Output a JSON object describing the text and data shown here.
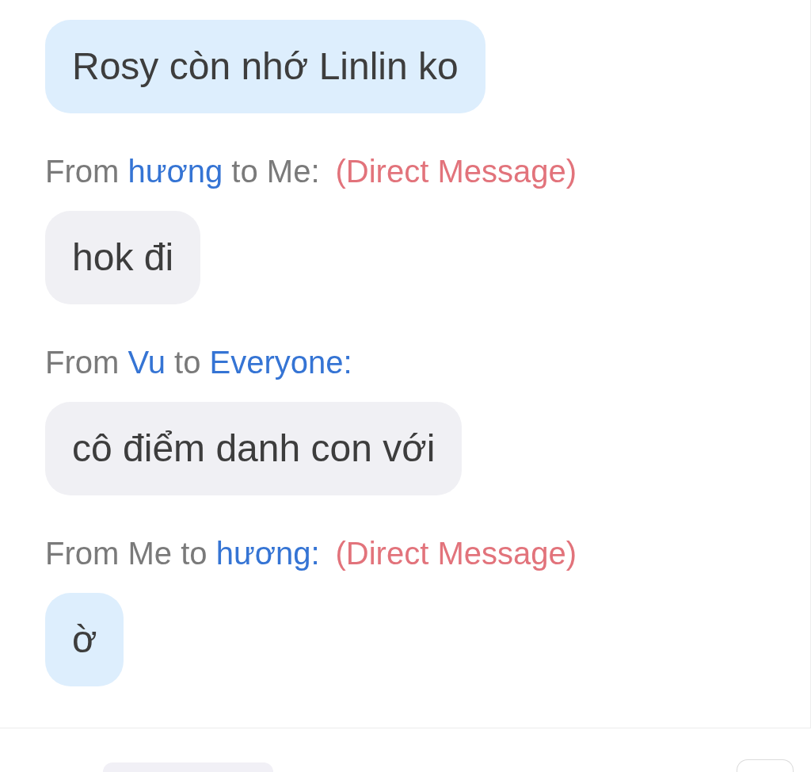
{
  "messages": [
    {
      "kind": "sent",
      "text": "Rosy còn nhớ Linlin ko"
    },
    {
      "header": {
        "from_label": "From",
        "from": {
          "name": "hương",
          "kind": "other"
        },
        "to_label": "to",
        "to": {
          "name": "Me",
          "kind": "self"
        },
        "colon": ":",
        "tag": "(Direct Message)"
      },
      "kind": "received",
      "text": "hok đi"
    },
    {
      "header": {
        "from_label": "From",
        "from": {
          "name": "Vu",
          "kind": "other"
        },
        "to_label": "to",
        "to": {
          "name": "Everyone",
          "kind": "other"
        },
        "colon": ":"
      },
      "kind": "received",
      "text": "cô điểm danh con với"
    },
    {
      "header": {
        "from_label": "From",
        "from": {
          "name": "Me",
          "kind": "self"
        },
        "to_label": "to",
        "to": {
          "name": "hương",
          "kind": "other"
        },
        "colon": ":",
        "tag": "(Direct Message)"
      },
      "kind": "sent",
      "text": "ờ"
    }
  ]
}
